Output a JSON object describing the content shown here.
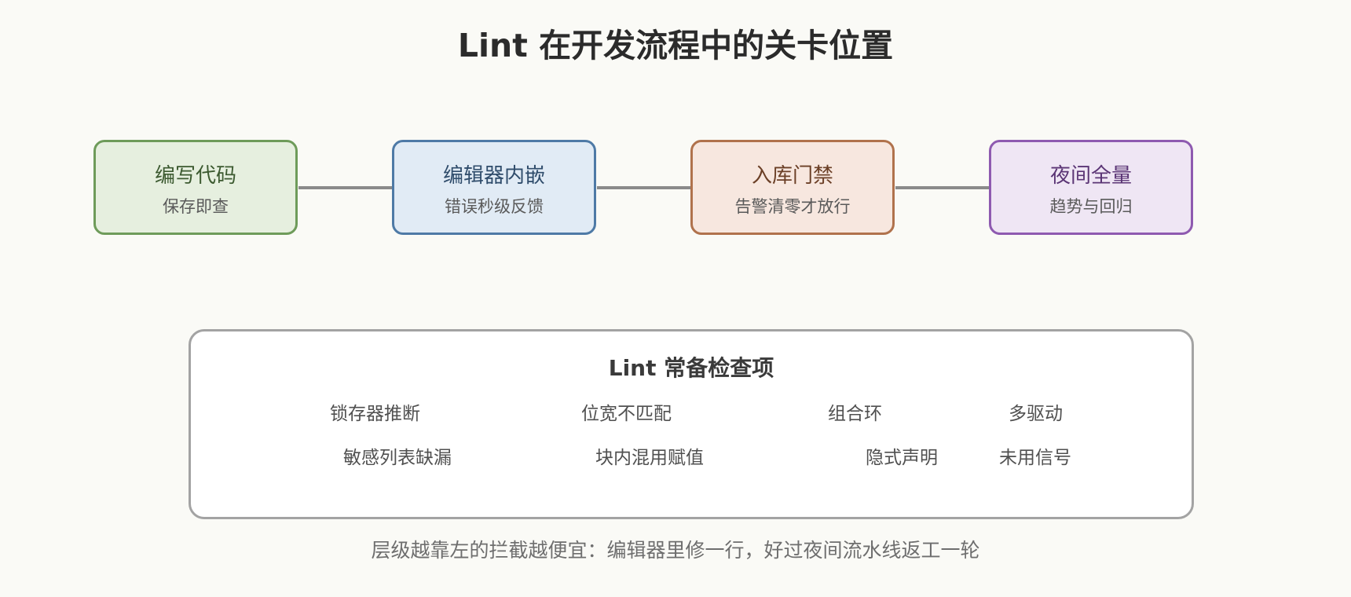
{
  "title": "Lint 在开发流程中的关卡位置",
  "stages": [
    {
      "name": "编写代码",
      "desc": "保存即查",
      "border": "#6e9b5a",
      "fill": "#e6efdf",
      "text": "#3c5a30"
    },
    {
      "name": "编辑器内嵌",
      "desc": "错误秒级反馈",
      "border": "#4e7aa6",
      "fill": "#e1ebf5",
      "text": "#2f4c6b"
    },
    {
      "name": "入库门禁",
      "desc": "告警清零才放行",
      "border": "#b0724c",
      "fill": "#f7e7df",
      "text": "#6b3f26"
    },
    {
      "name": "夜间全量",
      "desc": "趋势与回归",
      "border": "#8e5ab0",
      "fill": "#efe6f4",
      "text": "#5b3575"
    }
  ],
  "checks": {
    "title": "Lint 常备检查项",
    "items": [
      "锁存器推断",
      "位宽不匹配",
      "组合环",
      "多驱动",
      "敏感列表缺漏",
      "块内混用赋值",
      "隐式声明",
      "未用信号"
    ]
  },
  "footer": "层级越靠左的拦截越便宜：编辑器里修一行，好过夜间流水线返工一轮"
}
